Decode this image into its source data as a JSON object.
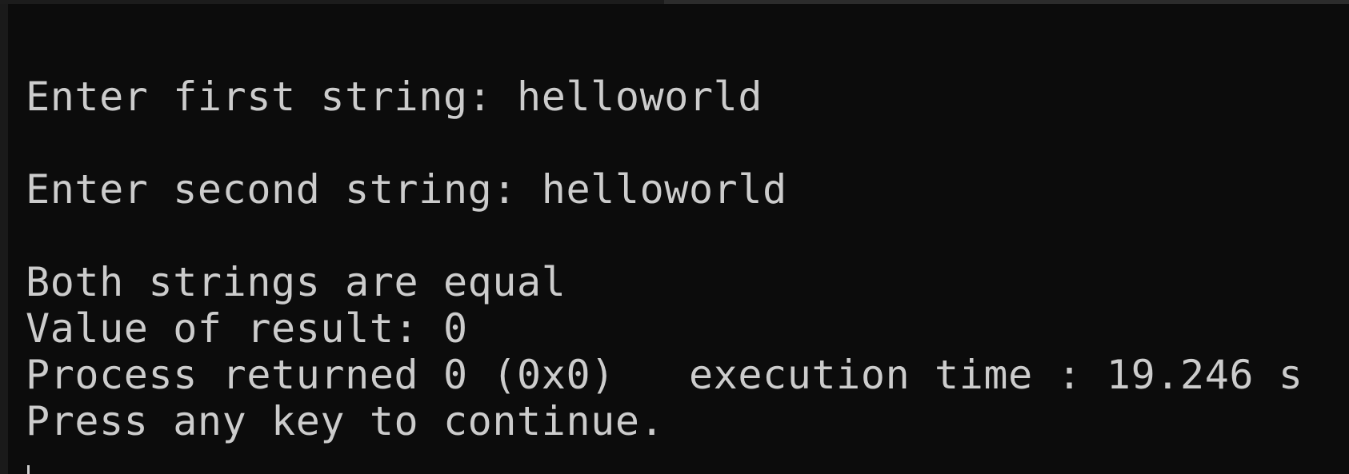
{
  "console": {
    "lines": [
      "Enter first string: helloworld",
      "",
      "Enter second string: helloworld",
      "",
      "Both strings are equal",
      "Value of result: 0",
      "Process returned 0 (0x0)   execution time : 19.246 s",
      "Press any key to continue."
    ]
  }
}
